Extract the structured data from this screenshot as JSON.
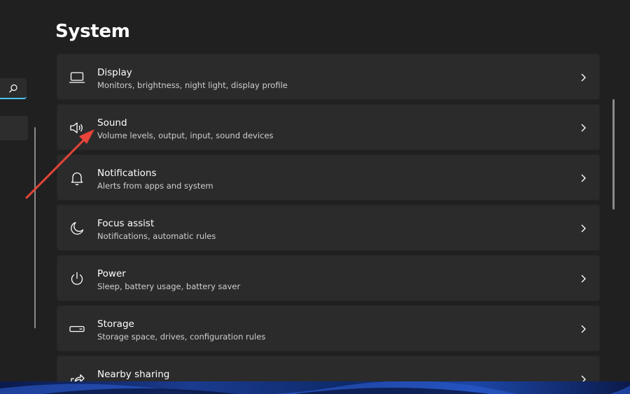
{
  "page": {
    "title": "System"
  },
  "items": [
    {
      "title": "Display",
      "subtitle": "Monitors, brightness, night light, display profile",
      "icon": "monitor-icon"
    },
    {
      "title": "Sound",
      "subtitle": "Volume levels, output, input, sound devices",
      "icon": "speaker-icon"
    },
    {
      "title": "Notifications",
      "subtitle": "Alerts from apps and system",
      "icon": "bell-icon"
    },
    {
      "title": "Focus assist",
      "subtitle": "Notifications, automatic rules",
      "icon": "moon-icon"
    },
    {
      "title": "Power",
      "subtitle": "Sleep, battery usage, battery saver",
      "icon": "power-icon"
    },
    {
      "title": "Storage",
      "subtitle": "Storage space, drives, configuration rules",
      "icon": "storage-icon"
    },
    {
      "title": "Nearby sharing",
      "subtitle": "",
      "icon": "share-icon"
    }
  ],
  "colors": {
    "accent": "#4cc2ff",
    "annotation_arrow": "#e8443a",
    "card": "#2b2b2b",
    "background": "#202020"
  }
}
